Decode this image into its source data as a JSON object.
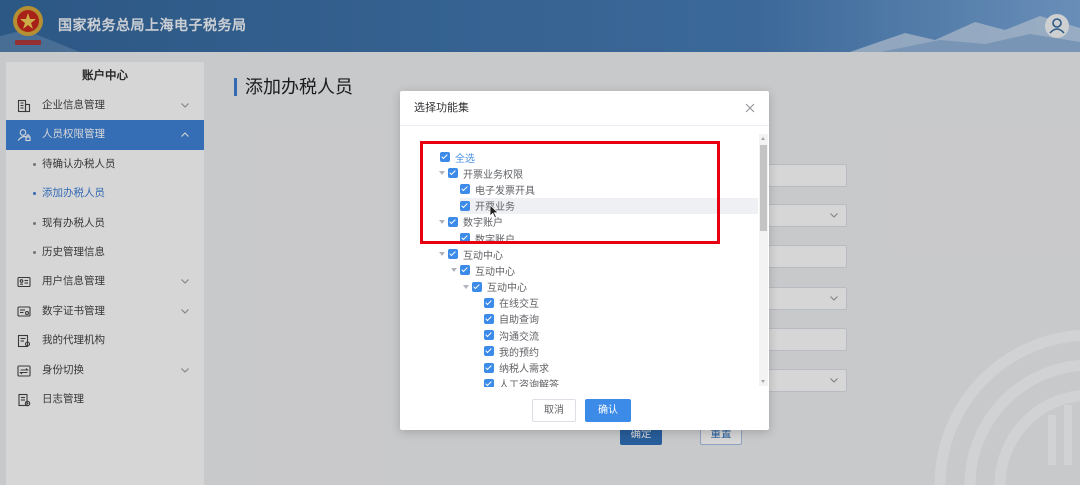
{
  "header": {
    "title": "国家税务总局上海电子税务局",
    "logo_icon": "national-emblem-icon",
    "avatar_icon": "user-avatar-icon"
  },
  "sidebar": {
    "title": "账户中心",
    "items": [
      {
        "label": "企业信息管理",
        "icon": "building-icon",
        "chevron_icon": "chevron-down-icon"
      },
      {
        "label": "人员权限管理",
        "icon": "user-permission-icon",
        "chevron_icon": "chevron-up-icon",
        "selected": true,
        "expanded": true,
        "children": [
          {
            "label": "待确认办税人员"
          },
          {
            "label": "添加办税人员",
            "active": true
          },
          {
            "label": "现有办税人员"
          },
          {
            "label": "历史管理信息"
          }
        ]
      },
      {
        "label": "用户信息管理",
        "icon": "id-card-icon",
        "chevron_icon": "chevron-down-icon"
      },
      {
        "label": "数字证书管理",
        "icon": "certificate-icon",
        "chevron_icon": "chevron-down-icon"
      },
      {
        "label": "我的代理机构",
        "icon": "agency-icon"
      },
      {
        "label": "身份切换",
        "icon": "switch-identity-icon",
        "chevron_icon": "chevron-down-icon"
      },
      {
        "label": "日志管理",
        "icon": "log-icon"
      }
    ]
  },
  "main": {
    "title": "添加办税人员",
    "form_buttons": {
      "submit_label": "确定",
      "reset_label": "重置"
    }
  },
  "modal": {
    "title": "选择功能集",
    "close_icon": "close-icon",
    "select_all": {
      "label": "全选",
      "checked": true
    },
    "tree": [
      {
        "label": "开票业务权限",
        "checked": true,
        "expanded": true,
        "children": [
          {
            "label": "电子发票开具",
            "checked": true
          },
          {
            "label": "开票业务",
            "checked": true,
            "hovered": true
          }
        ]
      },
      {
        "label": "数字账户",
        "checked": true,
        "expanded": true,
        "children": [
          {
            "label": "数字账户",
            "checked": true
          }
        ]
      },
      {
        "label": "互动中心",
        "checked": true,
        "expanded": true,
        "children": [
          {
            "label": "互动中心",
            "checked": true,
            "expanded": true,
            "children": [
              {
                "label": "互动中心",
                "checked": true,
                "expanded": true,
                "children": [
                  {
                    "label": "在线交互",
                    "checked": true
                  },
                  {
                    "label": "自助查询",
                    "checked": true
                  },
                  {
                    "label": "沟通交流",
                    "checked": true
                  },
                  {
                    "label": "我的预约",
                    "checked": true
                  },
                  {
                    "label": "纳税人需求",
                    "checked": true
                  },
                  {
                    "label": "人工咨询解答",
                    "checked": true
                  }
                ]
              }
            ]
          }
        ]
      }
    ],
    "cancel_label": "取消",
    "confirm_label": "确认"
  },
  "colors": {
    "header_blue": "#35699f",
    "menu_selected": "#4084d8",
    "accent": "#3d8be8",
    "highlight_box": "#e60012"
  }
}
